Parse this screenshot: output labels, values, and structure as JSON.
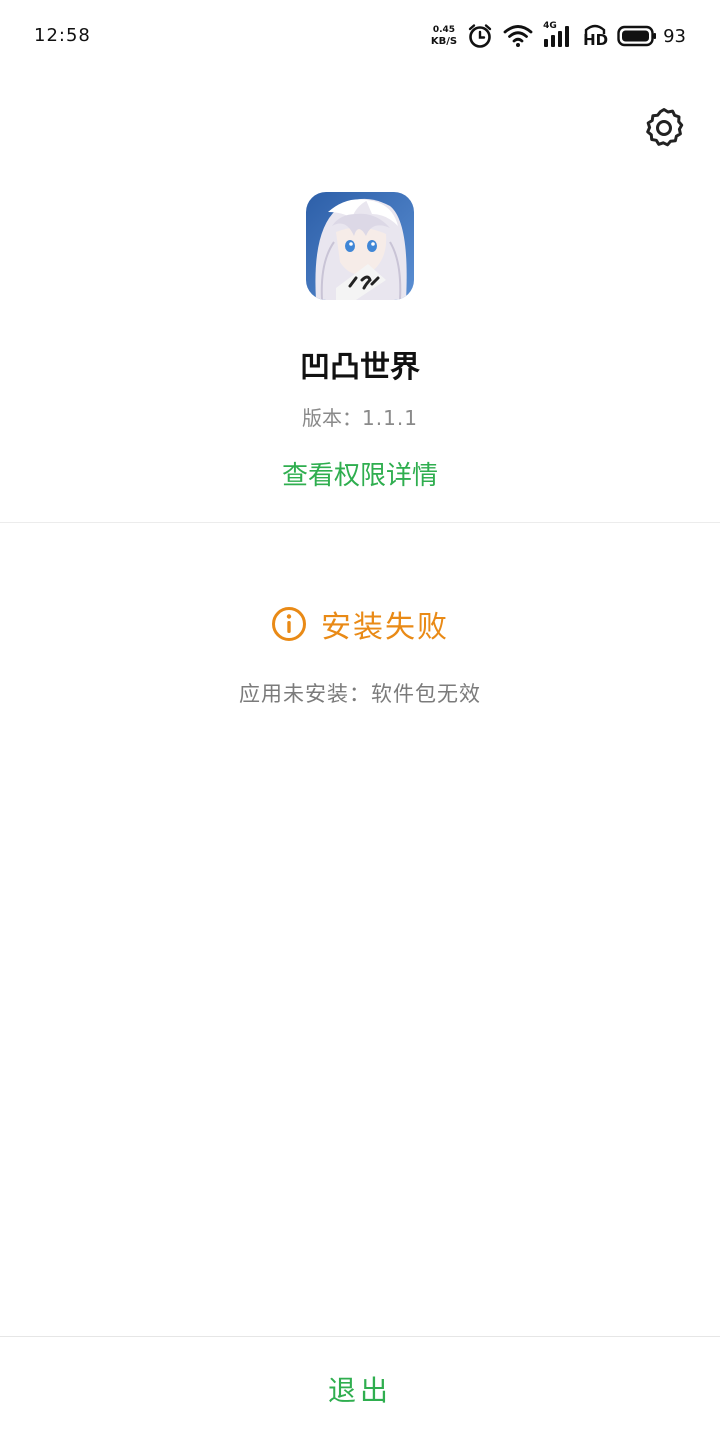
{
  "status_bar": {
    "time": "12:58",
    "net_speed_value": "0.45",
    "net_speed_unit": "KB/S",
    "network_type": "4G",
    "hd_label": "HD",
    "battery_level": "93",
    "icons": [
      "alarm-icon",
      "wifi-icon",
      "signal-4g-icon",
      "hd-icon",
      "battery-icon"
    ]
  },
  "header": {
    "settings_icon": "gear-icon"
  },
  "app": {
    "name": "凹凸世界",
    "version_label": "版本：",
    "version_value": "1.1.1",
    "permissions_link": "查看权限详情"
  },
  "result": {
    "icon": "info-circle-icon",
    "title": "安装失败",
    "description": "应用未安装：软件包无效"
  },
  "footer": {
    "exit_label": "退出"
  },
  "colors": {
    "accent_green": "#2fae4f",
    "warning_orange": "#e98a16",
    "muted_gray": "#8a8a8a"
  }
}
